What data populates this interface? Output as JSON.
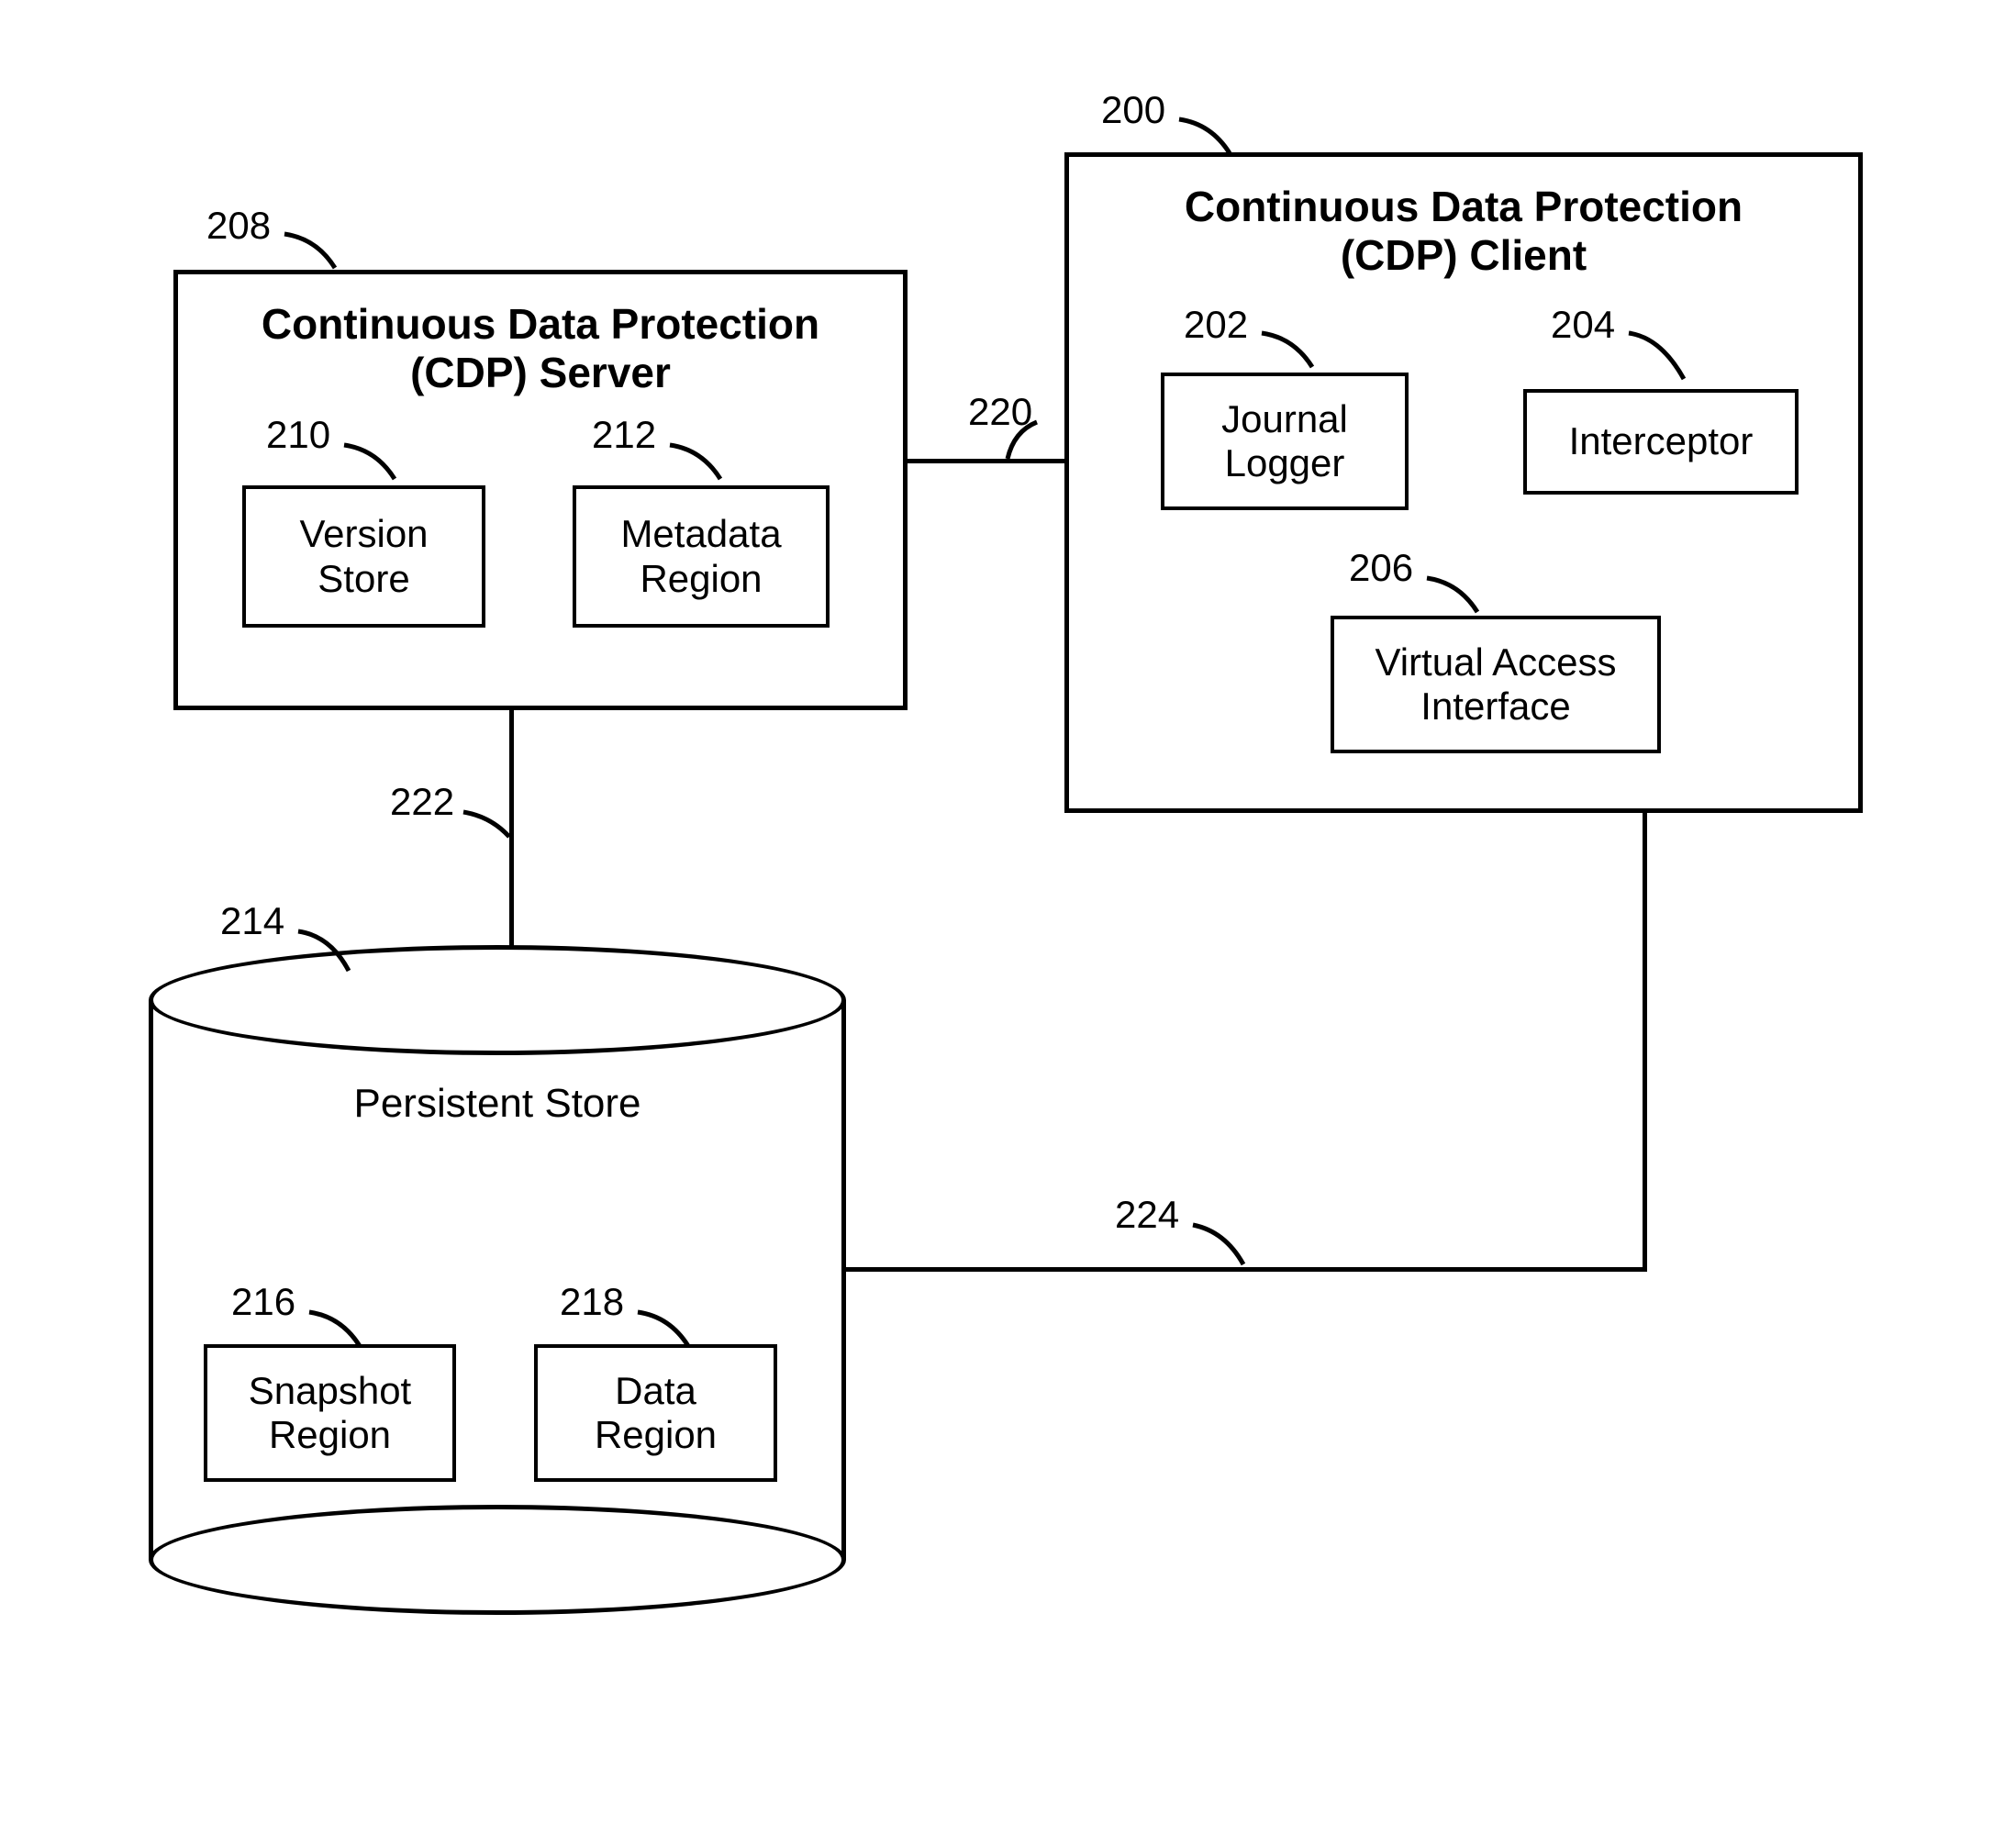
{
  "server": {
    "ref": "208",
    "title_line1": "Continuous Data Protection",
    "title_line2": "(CDP) Server",
    "version_store": {
      "ref": "210",
      "label_line1": "Version",
      "label_line2": "Store"
    },
    "metadata_region": {
      "ref": "212",
      "label_line1": "Metadata",
      "label_line2": "Region"
    }
  },
  "client": {
    "ref": "200",
    "title_line1": "Continuous Data Protection",
    "title_line2": "(CDP) Client",
    "journal_logger": {
      "ref": "202",
      "label_line1": "Journal",
      "label_line2": "Logger"
    },
    "interceptor": {
      "ref": "204",
      "label_line1": "Interceptor"
    },
    "virtual_access": {
      "ref": "206",
      "label_line1": "Virtual Access",
      "label_line2": "Interface"
    }
  },
  "persistent_store": {
    "ref": "214",
    "title": "Persistent Store",
    "snapshot_region": {
      "ref": "216",
      "label_line1": "Snapshot",
      "label_line2": "Region"
    },
    "data_region": {
      "ref": "218",
      "label_line1": "Data",
      "label_line2": "Region"
    }
  },
  "connectors": {
    "server_client": "220",
    "server_store": "222",
    "client_store": "224"
  }
}
